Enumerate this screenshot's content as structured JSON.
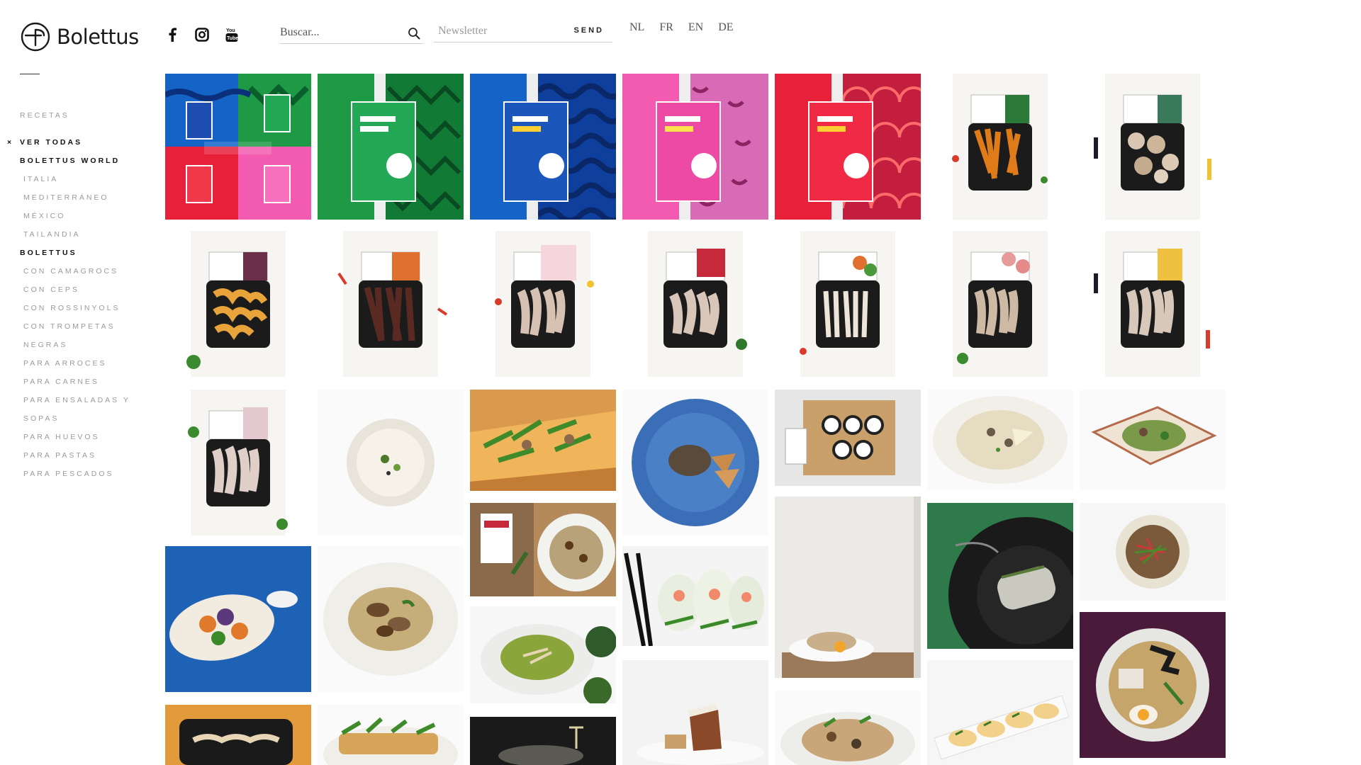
{
  "brand": {
    "name": "Bolettus"
  },
  "socials": [
    {
      "name": "facebook",
      "icon": "facebook-icon"
    },
    {
      "name": "instagram",
      "icon": "instagram-icon"
    },
    {
      "name": "youtube",
      "icon": "youtube-icon"
    }
  ],
  "search": {
    "placeholder": "Buscar..."
  },
  "newsletter": {
    "placeholder": "Newsletter",
    "send_label": "SEND"
  },
  "languages": [
    "NL",
    "FR",
    "EN",
    "DE"
  ],
  "nav": {
    "recetas": "RECETAS",
    "ver_todas": "VER TODAS",
    "close_mark": "×",
    "bolettus_world": "BOLETTUS WORLD",
    "world_items": [
      "ITALIA",
      "MEDITERRÁNEO",
      "MÉXICO",
      "TAILANDIA"
    ],
    "bolettus": "BOLETTUS",
    "bolettus_items": [
      "CON CAMAGROCS",
      "CON CEPS",
      "CON ROSSINYOLS",
      "CON TROMPETAS",
      "NEGRAS",
      "PARA ARROCES",
      "PARA CARNES",
      "PARA ENSALADAS Y",
      "SOPAS",
      "PARA HUEVOS",
      "PARA PASTAS",
      "PARA PESCADOS"
    ]
  },
  "colors": {
    "green": "#1e9a47",
    "blue": "#1464c8",
    "pink": "#f25bb0",
    "red": "#e8213a",
    "navy": "#12307a"
  }
}
